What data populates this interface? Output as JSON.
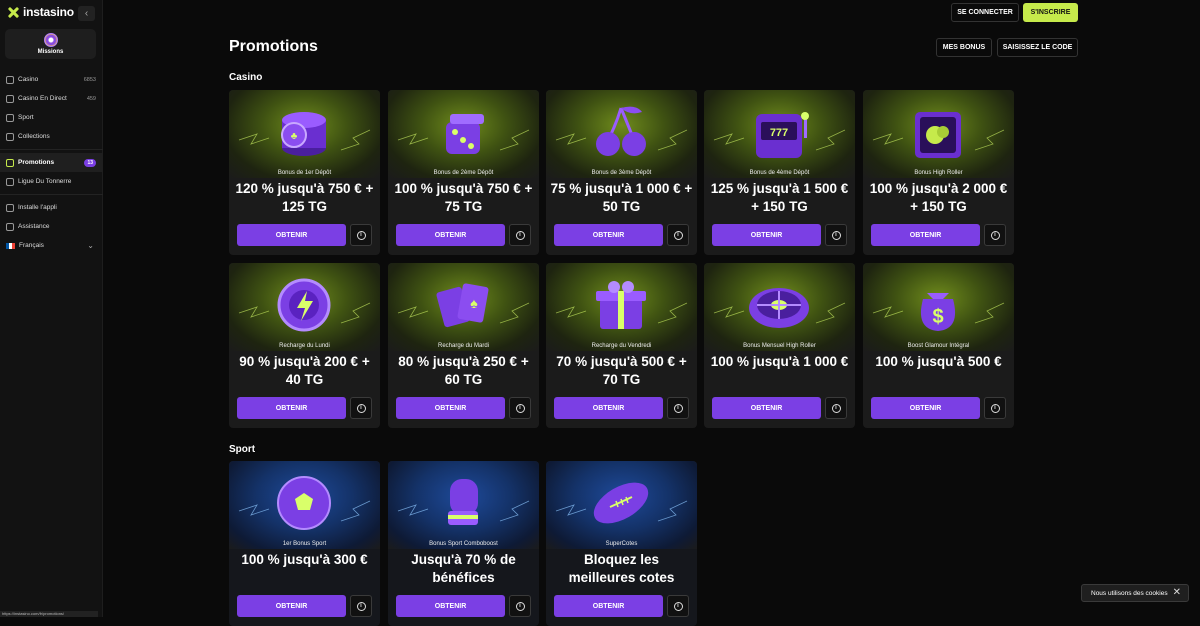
{
  "brand": {
    "name": "instasino"
  },
  "sidebar": {
    "missions_label": "Missions",
    "items": [
      {
        "label": "Casino",
        "count": "6853",
        "icon": "casino-icon"
      },
      {
        "label": "Casino En Direct",
        "count": "459",
        "icon": "live-casino-icon"
      },
      {
        "label": "Sport",
        "count": "",
        "icon": "sport-icon"
      },
      {
        "label": "Collections",
        "count": "",
        "icon": "collections-icon"
      },
      {
        "label": "Promotions",
        "badge": "13",
        "icon": "gift-icon",
        "active": true
      },
      {
        "label": "Ligue Du Tonnerre",
        "count": "",
        "icon": "league-icon"
      },
      {
        "label": "Installe l'appli",
        "count": "",
        "icon": "download-icon"
      },
      {
        "label": "Assistance",
        "count": "",
        "icon": "chat-icon"
      },
      {
        "label": "Français",
        "count": "",
        "icon": "flag-fr-icon"
      }
    ],
    "status_url": "https://instasino.com/fr/promotions/"
  },
  "header": {
    "login_label": "SE CONNECTER",
    "signup_label": "S'INSCRIRE"
  },
  "page": {
    "title": "Promotions",
    "my_bonus_label": "MES BONUS",
    "enter_code_label": "SAISISSEZ LE CODE"
  },
  "sections": {
    "casino": "Casino",
    "sport": "Sport"
  },
  "casino_cards": [
    {
      "subtitle": "Bonus de 1er Dépôt",
      "headline": "120 % jusqu'à 750 € + 125 TG",
      "cta": "OBTENIR",
      "icon": "chips-icon"
    },
    {
      "subtitle": "Bonus de 2ème Dépôt",
      "headline": "100 % jusqu'à 750 € + 75 TG",
      "cta": "OBTENIR",
      "icon": "dice-icon"
    },
    {
      "subtitle": "Bonus de 3ème Dépôt",
      "headline": "75 % jusqu'à 1 000 € + 50 TG",
      "cta": "OBTENIR",
      "icon": "cherries-icon"
    },
    {
      "subtitle": "Bonus de 4ème Dépôt",
      "headline": "125 % jusqu'à 1 500 € + 150 TG",
      "cta": "OBTENIR",
      "icon": "slot-machine-icon"
    },
    {
      "subtitle": "Bonus High Roller",
      "headline": "100 % jusqu'à 2 000 € + 150 TG",
      "cta": "OBTENIR",
      "icon": "safe-icon"
    },
    {
      "subtitle": "Recharge du Lundi",
      "headline": "90 % jusqu'à 200 € + 40 TG",
      "cta": "OBTENIR",
      "icon": "lightning-chip-icon"
    },
    {
      "subtitle": "Recharge du Mardi",
      "headline": "80 % jusqu'à 250 € + 60 TG",
      "cta": "OBTENIR",
      "icon": "cards-icon"
    },
    {
      "subtitle": "Recharge du Vendredi",
      "headline": "70 % jusqu'à 500 € + 70 TG",
      "cta": "OBTENIR",
      "icon": "gift-box-icon"
    },
    {
      "subtitle": "Bonus Mensuel High Roller",
      "headline": "100 % jusqu'à 1 000 €",
      "cta": "OBTENIR",
      "icon": "roulette-icon"
    },
    {
      "subtitle": "Boost Glamour Intégral",
      "headline": "100 % jusqu'à 500 €",
      "cta": "OBTENIR",
      "icon": "money-bag-icon"
    }
  ],
  "sport_cards": [
    {
      "subtitle": "1er Bonus Sport",
      "headline": "100 % jusqu'à 300 €",
      "cta": "OBTENIR",
      "icon": "soccer-ball-icon"
    },
    {
      "subtitle": "Bonus Sport Comboboost",
      "headline": "Jusqu'à 70 % de bénéfices",
      "cta": "OBTENIR",
      "icon": "boxing-glove-icon"
    },
    {
      "subtitle": "SuperCotes",
      "headline": "Bloquez les meilleures cotes",
      "cta": "OBTENIR",
      "icon": "football-icon"
    }
  ],
  "cookie": {
    "text": "Nous utilisons des cookies"
  },
  "colors": {
    "accent": "#c6ea4b",
    "purple": "#7b3fe4"
  }
}
